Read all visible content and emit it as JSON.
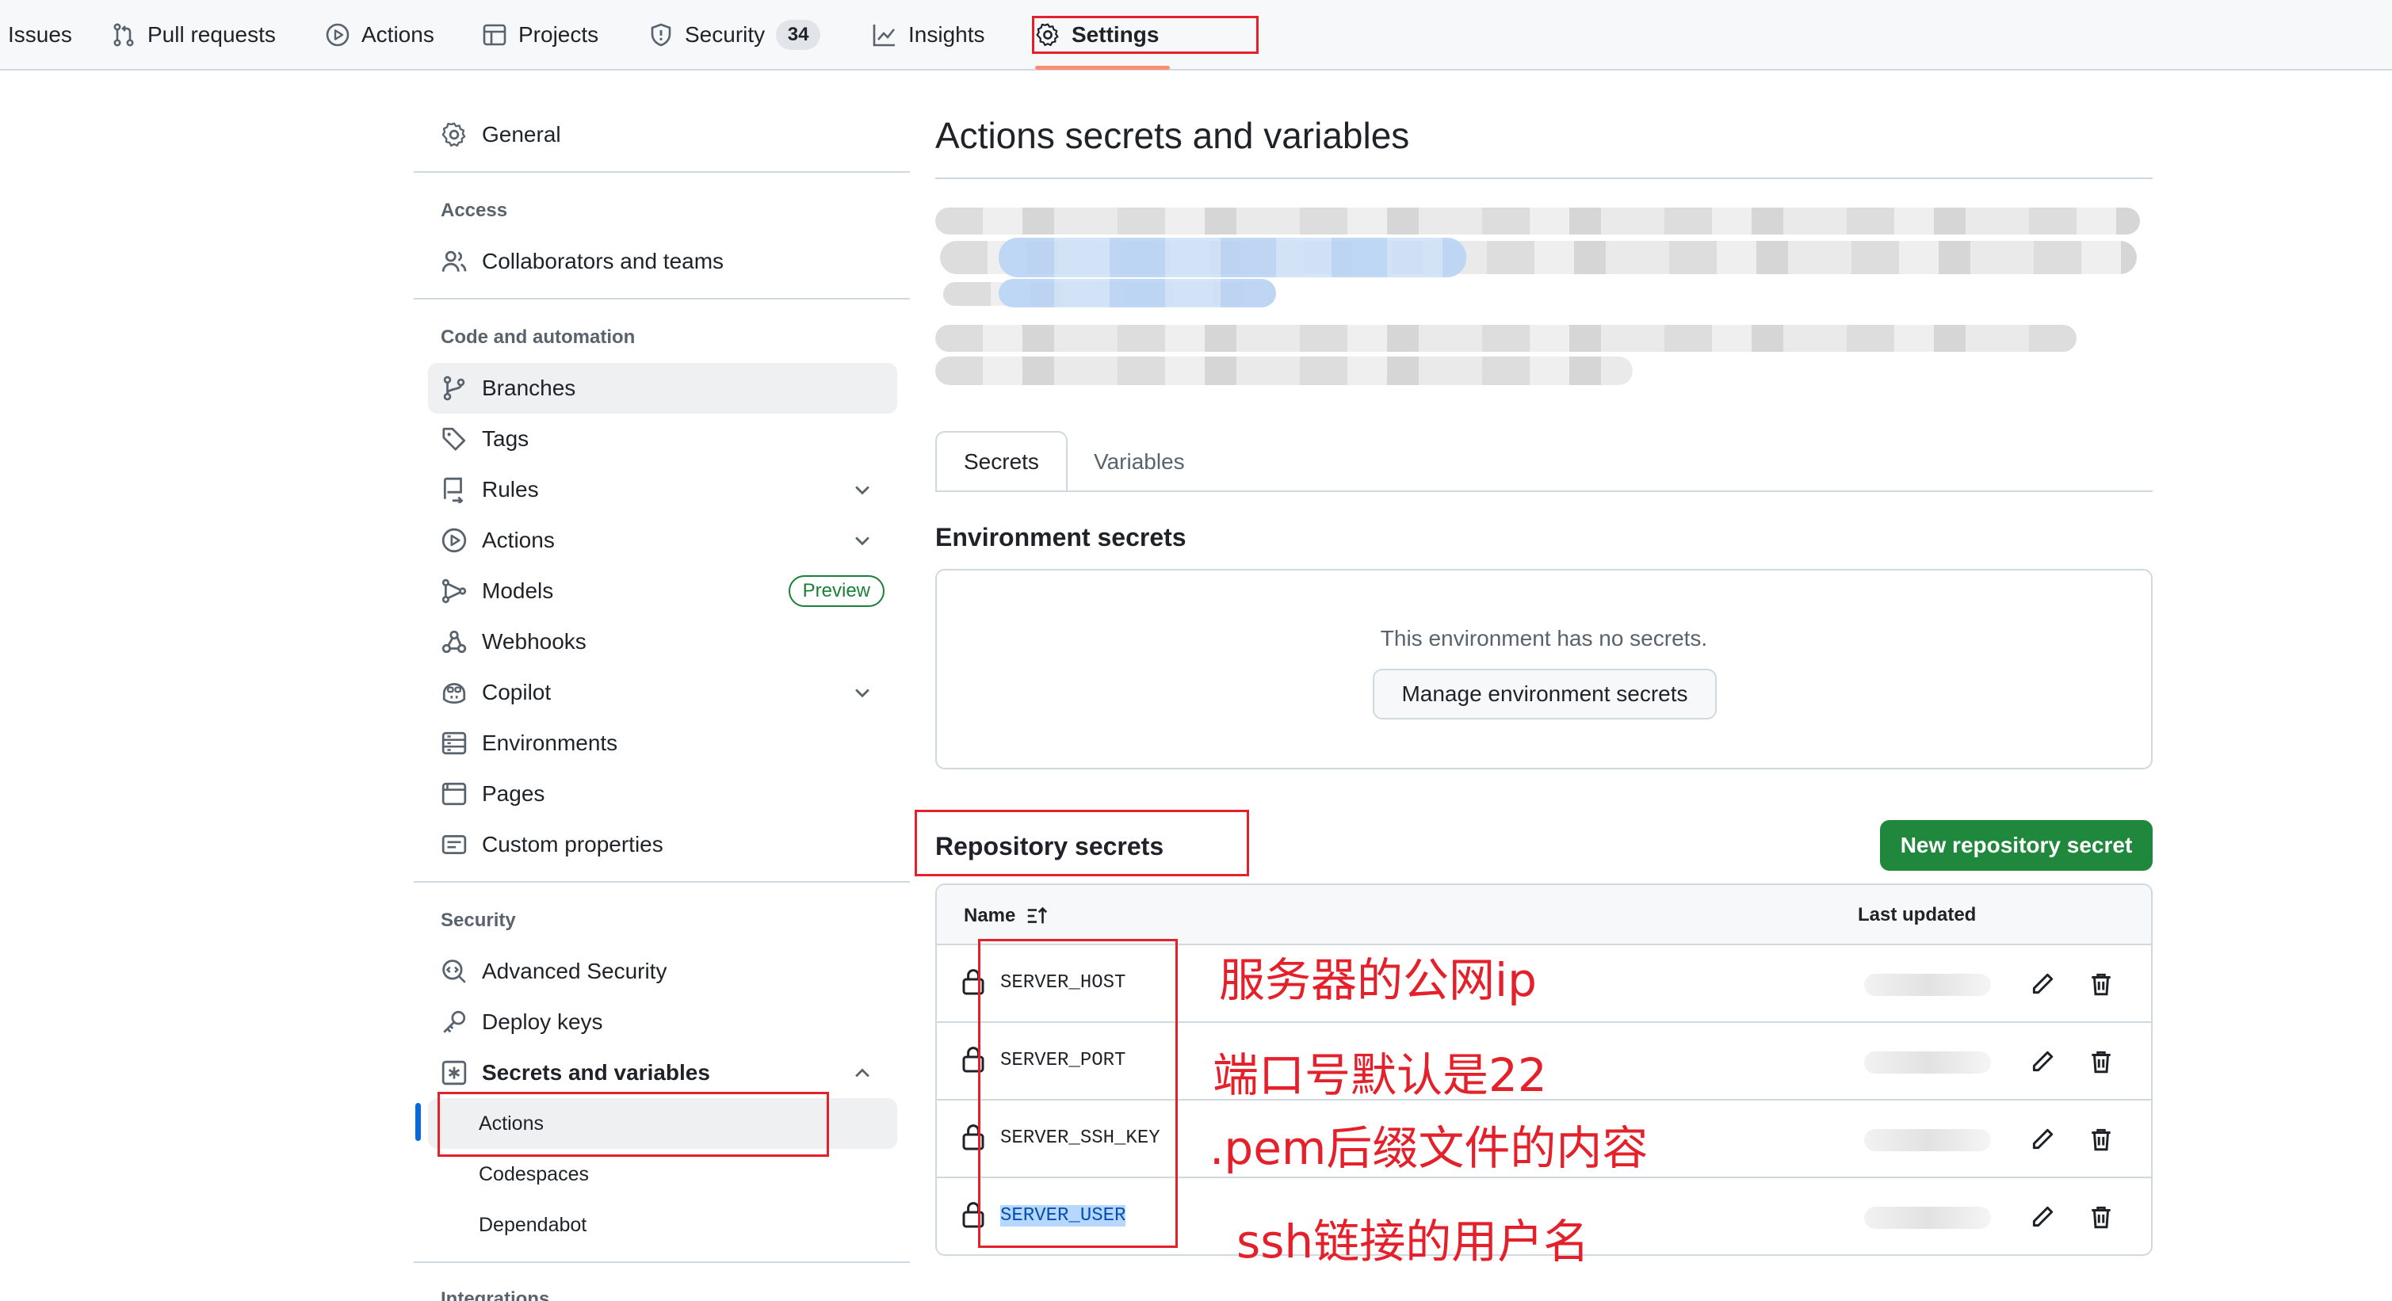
{
  "topnav": {
    "issues": "Issues",
    "pull_requests": "Pull requests",
    "actions": "Actions",
    "projects": "Projects",
    "security": "Security",
    "security_count": "34",
    "insights": "Insights",
    "settings": "Settings"
  },
  "sidebar": {
    "general": "General",
    "access_head": "Access",
    "collaborators": "Collaborators and teams",
    "code_head": "Code and automation",
    "branches": "Branches",
    "tags": "Tags",
    "rules": "Rules",
    "actions": "Actions",
    "models": "Models",
    "models_badge": "Preview",
    "webhooks": "Webhooks",
    "copilot": "Copilot",
    "environments": "Environments",
    "pages": "Pages",
    "custom_properties": "Custom properties",
    "security_head": "Security",
    "advanced_security": "Advanced Security",
    "deploy_keys": "Deploy keys",
    "secrets_vars": "Secrets and variables",
    "sub_actions": "Actions",
    "sub_codespaces": "Codespaces",
    "sub_dependabot": "Dependabot",
    "integrations_head": "Integrations"
  },
  "main": {
    "title": "Actions secrets and variables",
    "tabs": [
      "Secrets",
      "Variables"
    ],
    "env_heading": "Environment secrets",
    "env_empty": "This environment has no secrets.",
    "manage_env_button": "Manage environment secrets",
    "repo_heading": "Repository secrets",
    "new_secret_button": "New repository secret",
    "table": {
      "col_name": "Name",
      "col_updated": "Last updated",
      "rows": [
        {
          "name": "SERVER_HOST"
        },
        {
          "name": "SERVER_PORT"
        },
        {
          "name": "SERVER_SSH_KEY"
        },
        {
          "name": "SERVER_USER"
        }
      ]
    }
  },
  "annotations": {
    "host": "服务器的公网ip",
    "port": "端口号默认是22",
    "key": ".pem后缀文件的内容",
    "user": "ssh链接的用户名"
  },
  "colors": {
    "accent": "#0969da",
    "primary_button": "#1f883d",
    "annotation": "#e4202a",
    "nav_underline": "#fd8c73"
  }
}
